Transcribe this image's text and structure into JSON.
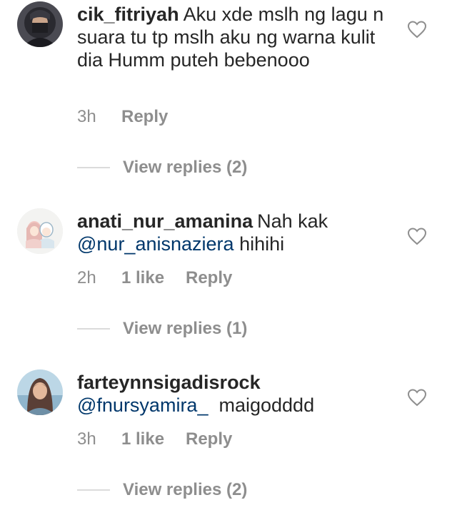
{
  "comments": [
    {
      "username": "cik_fitriyah",
      "text": "Aku xde mslh ng lagu n suara tu tp mslh aku ng warna kulit dia Humm puteh bebenooo",
      "time": "3h",
      "likes": "",
      "reply_label": "Reply",
      "view_replies": "View replies (2)",
      "avatar_icon": "avatar-hijab-woman-dark",
      "like_icon": "heart-outline-icon"
    },
    {
      "username": "anati_nur_amanina",
      "text_before": "Nah kak",
      "mention": "@nur_anisnaziera",
      "text_after": "hihihi",
      "time": "2h",
      "likes": "1 like",
      "reply_label": "Reply",
      "view_replies": "View replies (1)",
      "avatar_icon": "avatar-cartoon-couple",
      "like_icon": "heart-outline-icon"
    },
    {
      "username": "farteynnsigadisrock",
      "mention": "@fnursyamira_",
      "text_after": "maigodddd",
      "time": "3h",
      "likes": "1 like",
      "reply_label": "Reply",
      "view_replies": "View replies (2)",
      "avatar_icon": "avatar-woman-hijab-photo",
      "like_icon": "heart-outline-icon"
    }
  ],
  "colors": {
    "text": "#262626",
    "secondary": "#8e8e8e",
    "mention": "#00376b",
    "divider": "#dbdbdb"
  }
}
